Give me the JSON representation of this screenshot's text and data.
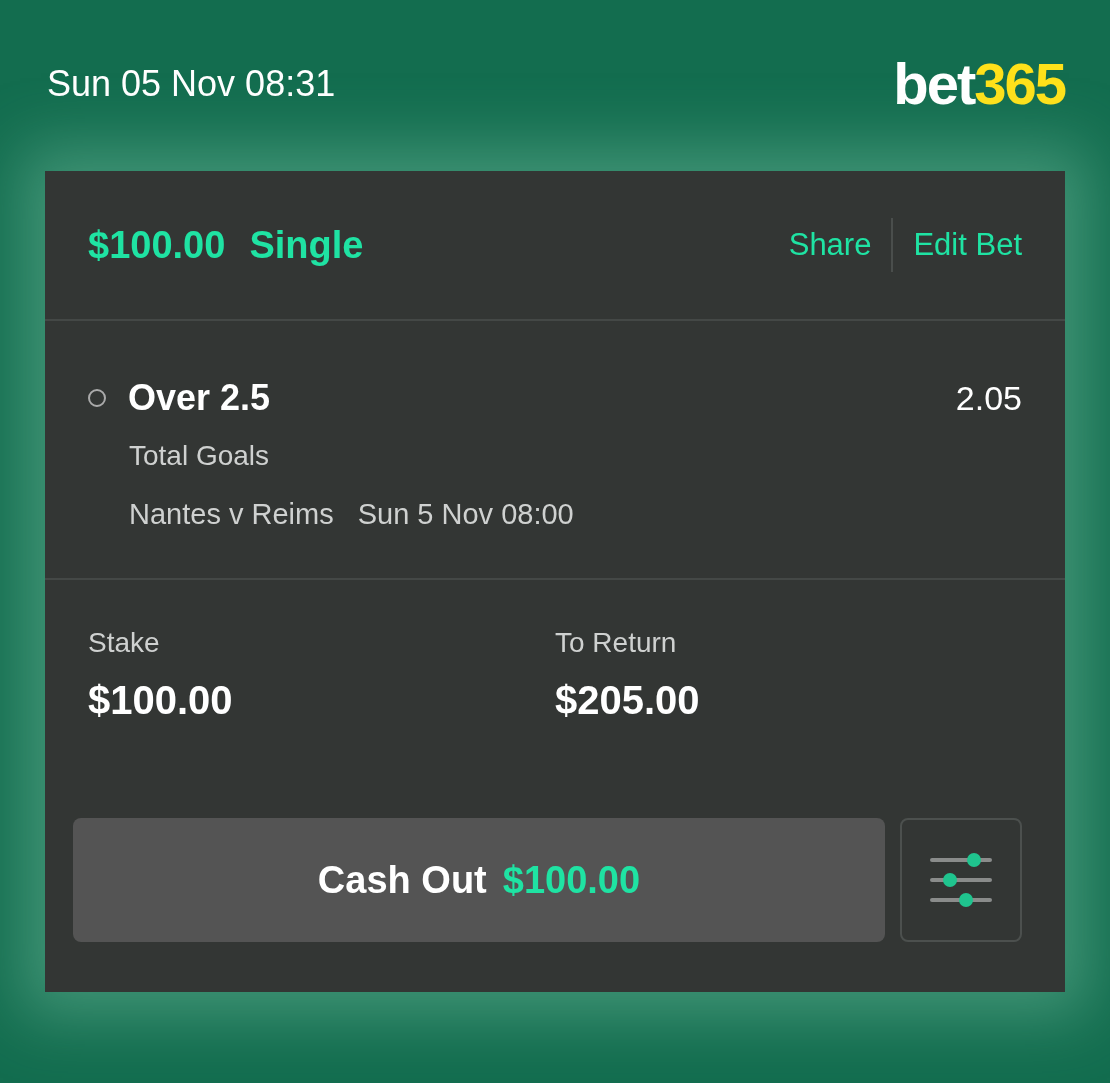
{
  "top_bar": {
    "datetime": "Sun 05 Nov 08:31",
    "logo": {
      "part_1": "bet",
      "part_2": "365"
    }
  },
  "bet": {
    "stake_amount": "$100.00",
    "type": "Single",
    "actions": [
      "Share",
      "Edit Bet"
    ],
    "selection": {
      "name": "Over 2.5",
      "odds": "2.05",
      "market": "Total Goals",
      "event": "Nantes v Reims",
      "start": "Sun 5 Nov 08:00"
    },
    "summary": [
      {
        "label": "Stake",
        "value": "$100.00"
      },
      {
        "label": "To Return",
        "value": "$205.00"
      }
    ],
    "cash_out": {
      "label": "Cash Out",
      "amount": "$100.00"
    }
  }
}
